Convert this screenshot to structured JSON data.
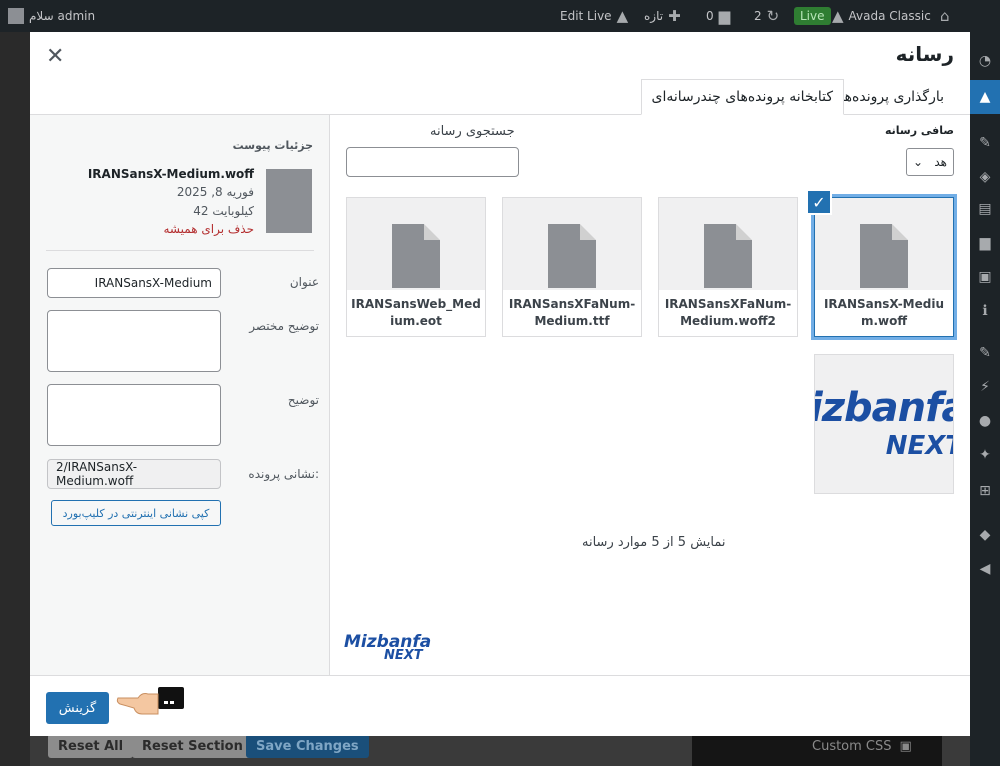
{
  "admin_bar": {
    "greeting": "سلام admin",
    "edit_live": "Edit Live",
    "new_label": "تازه",
    "comments_count": "0",
    "updates_count": "2",
    "live_badge": "Live",
    "theme_name": "Avada Classic"
  },
  "background": {
    "reset_all": "Reset All",
    "reset_section": "Reset Section",
    "save_changes": "Save Changes",
    "custom_css": "Custom CSS"
  },
  "modal": {
    "title": "رسانه",
    "tabs": [
      {
        "label": "بارگذاری پرونده‌ها",
        "active": false
      },
      {
        "label": "کتابخانه پرونده‌های چندرسانه‌ای",
        "active": true
      }
    ],
    "filter": {
      "label": "صافی رسانه",
      "selected": "هد"
    },
    "search": {
      "label": "جستجوی رسانه",
      "value": ""
    },
    "attachments": [
      {
        "name": "IRANSansX-Medium.woff",
        "selected": true
      },
      {
        "name": "IRANSansXFaNum-Medium.woff2",
        "selected": false
      },
      {
        "name": "IRANSansXFaNum-Medium.ttf",
        "selected": false
      },
      {
        "name": "IRANSansWeb_Medium.eot",
        "selected": false
      }
    ],
    "image_attachment": {
      "logo_top": "izbanfa",
      "logo_bottom": "NEXT"
    },
    "count_text": "نمایش 5 از 5 موارد رسانه",
    "details": {
      "heading": "جزئیات پیوست",
      "filename": "IRANSansX-Medium.woff",
      "date": "فوریه 8, 2025",
      "size": "42 کیلوبایت",
      "delete_link": "حذف برای همیشه",
      "title_label": "عنوان",
      "title_value": "IRANSansX-Medium",
      "caption_label": "توضیح مختصر",
      "caption_value": "",
      "description_label": "توضیح",
      "description_value": "",
      "url_label": "نشانی پرونده:",
      "url_value": "2/IRANSansX-Medium.woff",
      "copy_button": "کپی نشانی اینترنتی در کلیپ‌بورد"
    },
    "watermark": {
      "line1_a": "M",
      "line1_b": "izbanfa",
      "line2": "NEXT"
    },
    "select_button": "گزینش"
  },
  "colors": {
    "accent": "#2271b1",
    "danger": "#b32d2e",
    "admin_bar": "#1d2327"
  }
}
